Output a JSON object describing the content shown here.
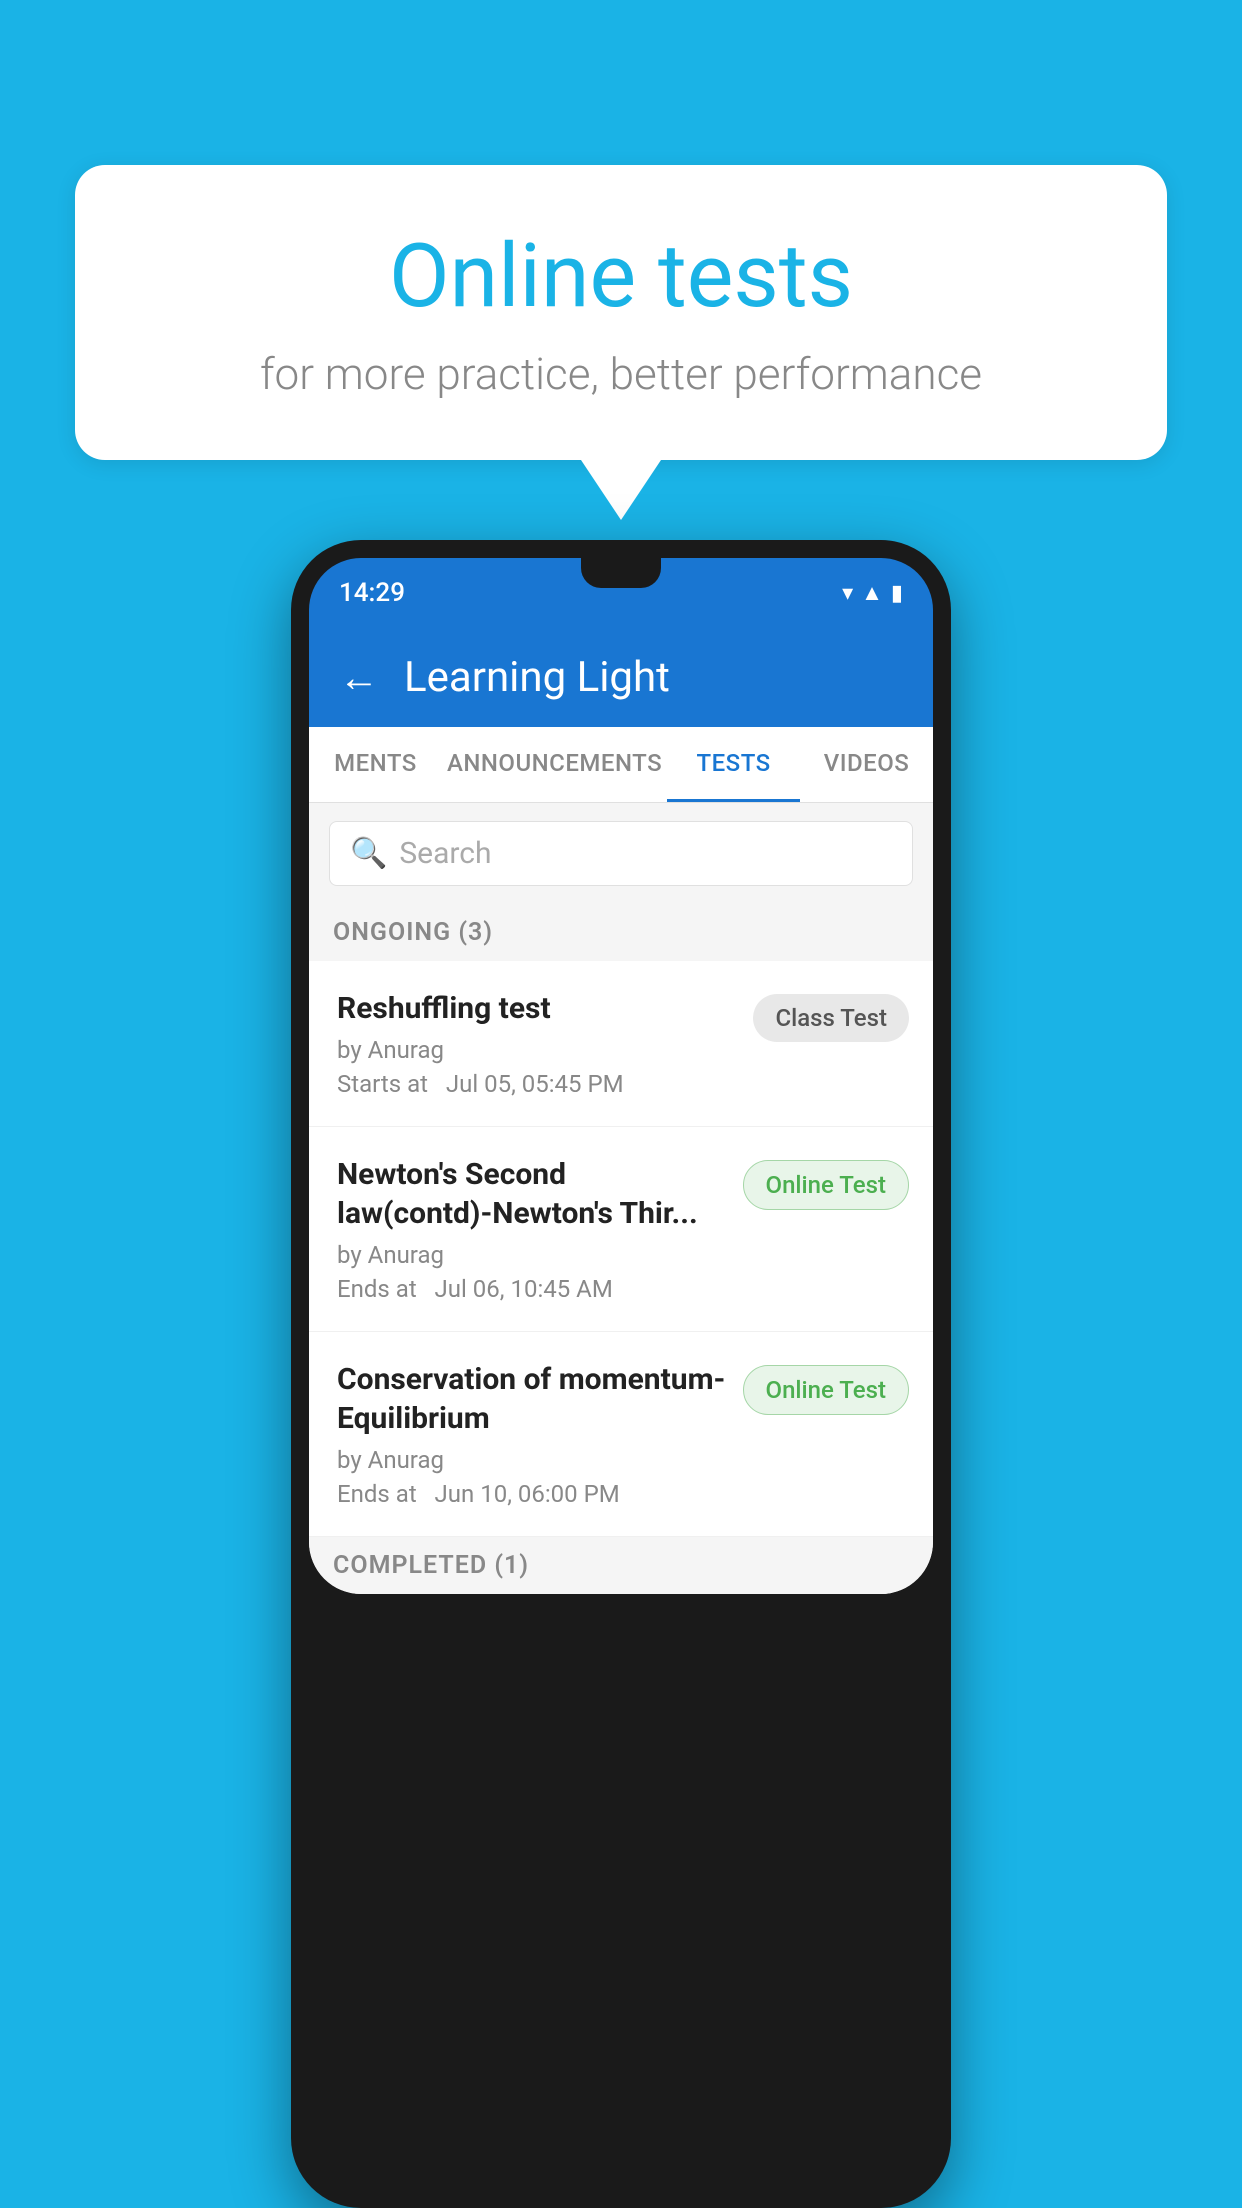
{
  "background_color": "#1ab3e6",
  "speech_bubble": {
    "title": "Online tests",
    "subtitle": "for more practice, better performance"
  },
  "phone": {
    "status_bar": {
      "time": "14:29",
      "icons": [
        "wifi",
        "signal",
        "battery"
      ]
    },
    "app_header": {
      "back_label": "←",
      "title": "Learning Light"
    },
    "tabs": [
      {
        "label": "MENTS",
        "active": false
      },
      {
        "label": "ANNOUNCEMENTS",
        "active": false
      },
      {
        "label": "TESTS",
        "active": true
      },
      {
        "label": "VIDEOS",
        "active": false
      }
    ],
    "search": {
      "placeholder": "Search"
    },
    "ongoing_section": {
      "title": "ONGOING (3)",
      "items": [
        {
          "name": "Reshuffling test",
          "by": "by Anurag",
          "time_label": "Starts at",
          "time": "Jul 05, 05:45 PM",
          "badge": "Class Test",
          "badge_type": "class"
        },
        {
          "name": "Newton's Second law(contd)-Newton's Thir...",
          "by": "by Anurag",
          "time_label": "Ends at",
          "time": "Jul 06, 10:45 AM",
          "badge": "Online Test",
          "badge_type": "online"
        },
        {
          "name": "Conservation of momentum-Equilibrium",
          "by": "by Anurag",
          "time_label": "Ends at",
          "time": "Jun 10, 06:00 PM",
          "badge": "Online Test",
          "badge_type": "online"
        }
      ]
    },
    "completed_section": {
      "title": "COMPLETED (1)"
    }
  }
}
